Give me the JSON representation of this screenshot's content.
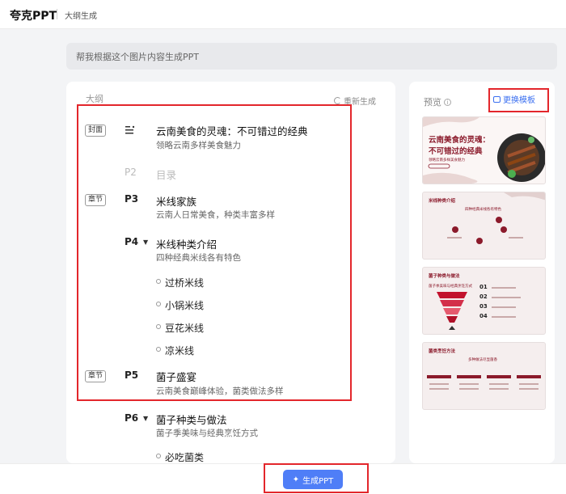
{
  "app": {
    "brand": "夸克PPT",
    "page_label": "大纲生成"
  },
  "prompt": {
    "text": "帮我根据这个图片内容生成PPT"
  },
  "outline": {
    "title": "大纲",
    "regenerate_label": "重新生成",
    "cover": {
      "tag": "封面",
      "title": "云南美食的灵魂：不可错过的经典",
      "subtitle": "领略云南多样美食魅力"
    },
    "p2": {
      "num": "P2",
      "title": "目录"
    },
    "p3": {
      "tag": "章节",
      "num": "P3",
      "title": "米线家族",
      "subtitle": "云南人日常美食，种类丰富多样"
    },
    "p4": {
      "num": "P4",
      "title": "米线种类介绍",
      "subtitle": "四种经典米线各有特色",
      "items": [
        "过桥米线",
        "小锅米线",
        "豆花米线",
        "凉米线"
      ]
    },
    "p5": {
      "tag": "章节",
      "num": "P5",
      "title": "菌子盛宴",
      "subtitle": "云南美食巅峰体验，菌类做法多样"
    },
    "p6": {
      "num": "P6",
      "title": "菌子种类与做法",
      "subtitle": "菌子季美味与经典烹饪方式",
      "items": [
        "必吃菌类"
      ]
    }
  },
  "preview": {
    "title": "预览",
    "template_button": "更换模板",
    "thumbs": {
      "t1": {
        "title_line1": "云南美食的灵魂：",
        "title_line2": "不可错过的经典",
        "sub": "领略云南多样美食魅力"
      },
      "t2": {
        "title": "米线种类介绍",
        "sub": "四种经典米线各有特色"
      },
      "t3": {
        "title": "菌子种类与做法",
        "sub": "菌子季美味与经典烹饪方式",
        "nums": [
          "01",
          "02",
          "03",
          "04"
        ]
      },
      "t4": {
        "title": "菌类烹饪方法",
        "sub": "多种做法尽显菌香"
      }
    }
  },
  "footer": {
    "generate_label": "生成PPT"
  },
  "colors": {
    "accent": "#4f7ef7",
    "highlight": "#e3262b",
    "theme": "#8b1a2b"
  }
}
